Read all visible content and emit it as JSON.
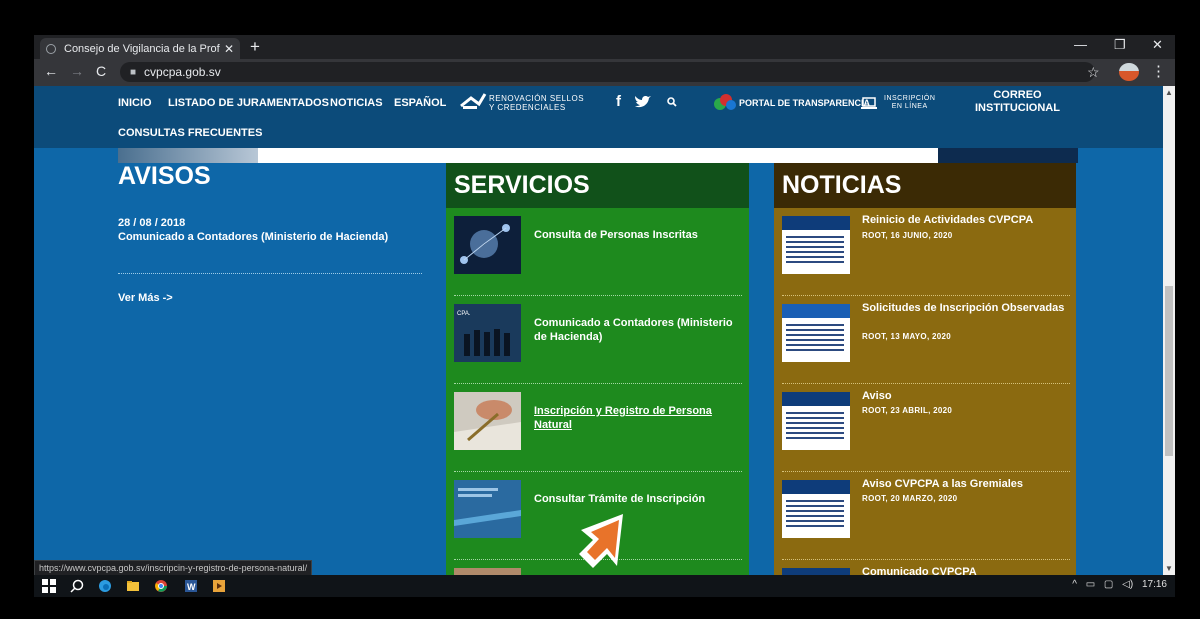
{
  "browser": {
    "tab_title": "Consejo de Vigilancia de la Profe",
    "tab_close": "✕",
    "new_tab": "+",
    "url": "cvpcpa.gob.sv",
    "status_url": "https://www.cvpcpa.gob.sv/inscripcin-y-registro-de-persona-natural/",
    "window_controls": [
      "—",
      "❐",
      "✕"
    ]
  },
  "nav": {
    "items": [
      "INICIO",
      "LISTADO DE JURAMENTADOS",
      "NOTICIAS",
      "ESPAÑOL"
    ],
    "renovacion": [
      "RENOVACIÓN SELLOS",
      "Y CREDENCIALES"
    ],
    "portal": "PORTAL DE TRANSPARENCIA",
    "inscripcion": [
      "INSCRIPCIÓN",
      "EN LÍNEA"
    ],
    "correo": [
      "CORREO",
      "INSTITUCIONAL"
    ],
    "consultas": "CONSULTAS FRECUENTES",
    "social_icons": [
      "facebook-icon",
      "twitter-icon",
      "search-icon"
    ]
  },
  "avisos": {
    "title": "AVISOS",
    "date": "28 / 08 / 2018",
    "text": "Comunicado a Contadores (Ministerio de Hacienda)",
    "more": "Ver Más ->"
  },
  "servicios": {
    "title": "SERVICIOS",
    "items": [
      {
        "label": "Consulta de Personas Inscritas"
      },
      {
        "label": "Comunicado a Contadores (Ministerio de Hacienda)"
      },
      {
        "label": "Inscripción y Registro de Persona Natural"
      },
      {
        "label": "Consultar Trámite de Inscripción"
      }
    ]
  },
  "noticias": {
    "title": "NOTICIAS",
    "items": [
      {
        "title": "Reinicio de Actividades CVPCPA",
        "meta": "ROOT, 16 JUNIO, 2020"
      },
      {
        "title": "Solicitudes de Inscripción Observadas",
        "meta": "ROOT, 13 MAYO, 2020"
      },
      {
        "title": "Aviso",
        "meta": "ROOT, 23 ABRIL, 2020"
      },
      {
        "title": "Aviso CVPCPA a las Gremiales",
        "meta": "ROOT, 20 MARZO, 2020"
      },
      {
        "title": "Comunicado CVPCPA",
        "meta": ""
      }
    ]
  },
  "taskbar": {
    "clock": "17:16",
    "apps": [
      "windows-start-icon",
      "search-icon",
      "edge-icon",
      "file-explorer-icon",
      "chrome-icon",
      "word-icon",
      "media-player-icon"
    ]
  },
  "colors": {
    "page_bg": "#0e67a8",
    "nav_bg": "#0c4b7a",
    "servicios_bg": "#1e8a1e",
    "servicios_head": "#11511a",
    "noticias_bg": "#8b6a10",
    "noticias_head": "#3b2a05"
  }
}
